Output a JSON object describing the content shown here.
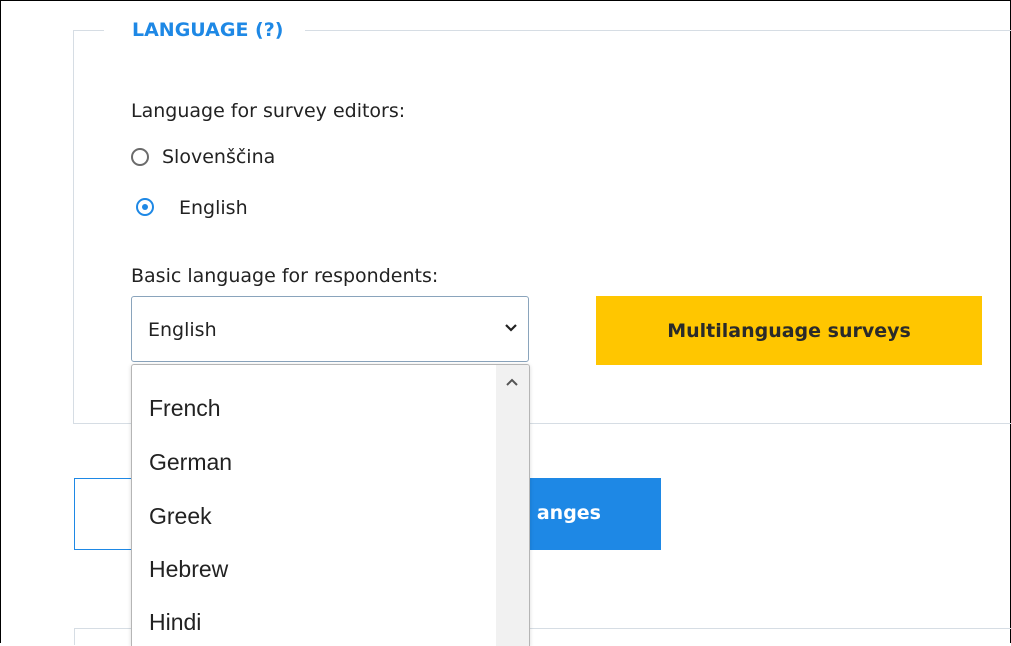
{
  "language_section": {
    "legend": "LANGUAGE (?)",
    "editors_label": "Language for survey editors:",
    "editor_options": [
      {
        "label": "Slovenščina",
        "checked": false
      },
      {
        "label": "English",
        "checked": true
      }
    ],
    "respondents_label": "Basic language for respondents:",
    "respondent_select": {
      "selected": "English",
      "options_visible": [
        "French",
        "German",
        "Greek",
        "Hebrew",
        "Hindi"
      ]
    },
    "multilanguage_button": "Multilanguage surveys"
  },
  "save_button": {
    "label_visible": "anges"
  },
  "colors": {
    "accent": "#1e88e5",
    "yellow_button": "#ffc600",
    "border": "#d6dde4"
  },
  "icons": [
    "chevron-down-icon",
    "scroll-up-arrow-icon"
  ]
}
